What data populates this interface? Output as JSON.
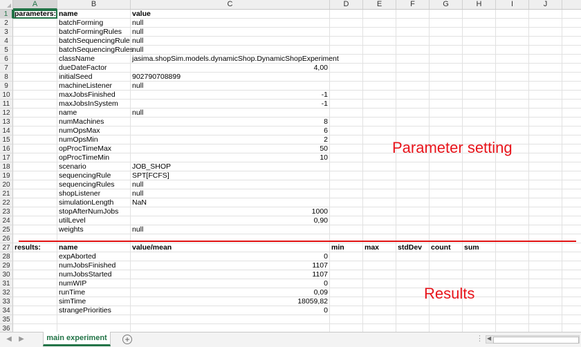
{
  "columns": [
    "A",
    "B",
    "C",
    "D",
    "E",
    "F",
    "G",
    "H",
    "I",
    "J"
  ],
  "selected_column": "A",
  "selected_row": 1,
  "rows": [
    {
      "n": "1",
      "a": "parameters:",
      "b": "name",
      "c": "value",
      "c_align": "left",
      "bold": true
    },
    {
      "n": "2",
      "b": "batchForming",
      "c": "null",
      "c_align": "left"
    },
    {
      "n": "3",
      "b": "batchFormingRules",
      "c": "null",
      "c_align": "left"
    },
    {
      "n": "4",
      "b": "batchSequencingRule",
      "c": "null",
      "c_align": "left"
    },
    {
      "n": "5",
      "b": "batchSequencingRules",
      "c": "null",
      "c_align": "left"
    },
    {
      "n": "6",
      "b": "className",
      "c": "jasima.shopSim.models.dynamicShop.DynamicShopExperiment",
      "c_align": "left"
    },
    {
      "n": "7",
      "b": "dueDateFactor",
      "c": "4,00",
      "c_align": "right"
    },
    {
      "n": "8",
      "b": "initialSeed",
      "c": "902790708899",
      "c_align": "left"
    },
    {
      "n": "9",
      "b": "machineListener",
      "c": "null",
      "c_align": "left"
    },
    {
      "n": "10",
      "b": "maxJobsFinished",
      "c": "-1",
      "c_align": "right"
    },
    {
      "n": "11",
      "b": "maxJobsInSystem",
      "c": "-1",
      "c_align": "right"
    },
    {
      "n": "12",
      "b": "name",
      "c": "null",
      "c_align": "left"
    },
    {
      "n": "13",
      "b": "numMachines",
      "c": "8",
      "c_align": "right"
    },
    {
      "n": "14",
      "b": "numOpsMax",
      "c": "6",
      "c_align": "right"
    },
    {
      "n": "15",
      "b": "numOpsMin",
      "c": "2",
      "c_align": "right"
    },
    {
      "n": "16",
      "b": "opProcTimeMax",
      "c": "50",
      "c_align": "right"
    },
    {
      "n": "17",
      "b": "opProcTimeMin",
      "c": "10",
      "c_align": "right"
    },
    {
      "n": "18",
      "b": "scenario",
      "c": "JOB_SHOP",
      "c_align": "left"
    },
    {
      "n": "19",
      "b": "sequencingRule",
      "c": "SPT[FCFS]",
      "c_align": "left"
    },
    {
      "n": "20",
      "b": "sequencingRules",
      "c": "null",
      "c_align": "left"
    },
    {
      "n": "21",
      "b": "shopListener",
      "c": "null",
      "c_align": "left"
    },
    {
      "n": "22",
      "b": "simulationLength",
      "c": "NaN",
      "c_align": "left"
    },
    {
      "n": "23",
      "b": "stopAfterNumJobs",
      "c": "1000",
      "c_align": "right"
    },
    {
      "n": "24",
      "b": "utilLevel",
      "c": "0,90",
      "c_align": "right"
    },
    {
      "n": "25",
      "b": "weights",
      "c": "null",
      "c_align": "left"
    },
    {
      "n": "26"
    },
    {
      "n": "27",
      "a": "results:",
      "b": "name",
      "c": "value/mean",
      "c_align": "left",
      "d": "min",
      "e": "max",
      "f": "stdDev",
      "g": "count",
      "h": "sum",
      "bold": true
    },
    {
      "n": "28",
      "b": "expAborted",
      "c": "0",
      "c_align": "right"
    },
    {
      "n": "29",
      "b": "numJobsFinished",
      "c": "1107",
      "c_align": "right"
    },
    {
      "n": "30",
      "b": "numJobsStarted",
      "c": "1107",
      "c_align": "right"
    },
    {
      "n": "31",
      "b": "numWIP",
      "c": "0",
      "c_align": "right"
    },
    {
      "n": "32",
      "b": "runTime",
      "c": "0,09",
      "c_align": "right"
    },
    {
      "n": "33",
      "b": "simTime",
      "c": "18059,82",
      "c_align": "right"
    },
    {
      "n": "34",
      "b": "strangePriorities",
      "c": "0",
      "c_align": "right"
    },
    {
      "n": "35"
    },
    {
      "n": "36"
    }
  ],
  "annotations": {
    "parameter_setting": "Parameter setting",
    "results": "Results"
  },
  "sheet_tab": "main experiment",
  "colors": {
    "accent": "#217346",
    "annotation": "#e8141b"
  }
}
